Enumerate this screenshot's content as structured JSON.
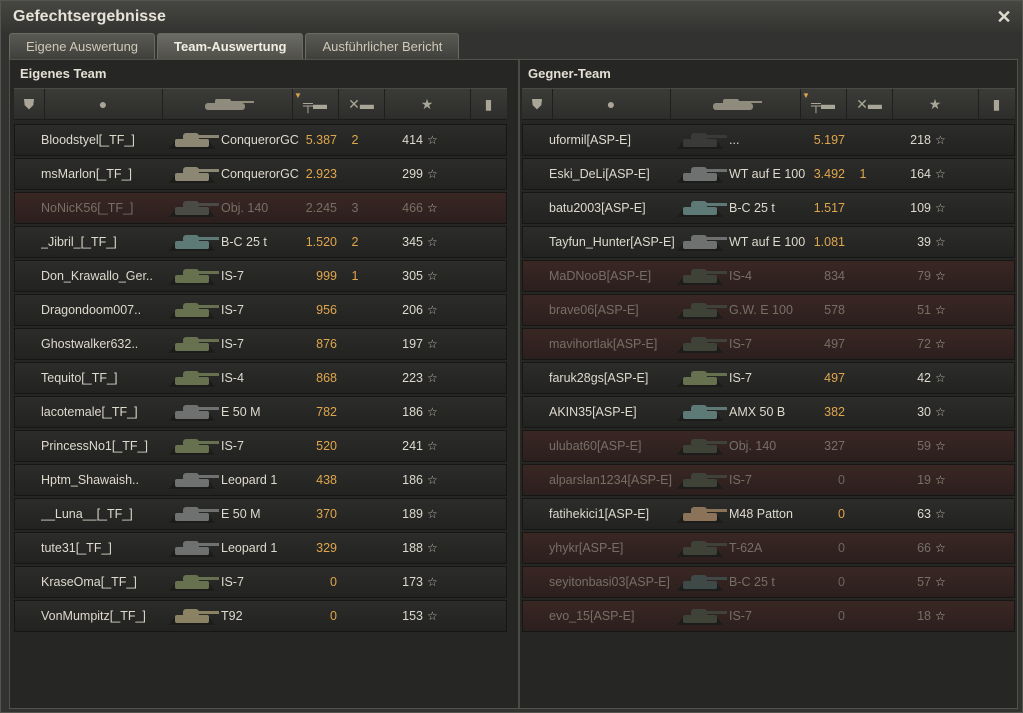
{
  "window": {
    "title": "Gefechtsergebnisse",
    "close_glyph": "✕"
  },
  "tabs": [
    {
      "label": "Eigene Auswertung",
      "active": false
    },
    {
      "label": "Team-Auswertung",
      "active": true
    },
    {
      "label": "Ausführlicher Bericht",
      "active": false
    }
  ],
  "icons": {
    "squad": "shield-icon",
    "player": "person-icon",
    "tank": "tank-icon",
    "damage": "damage-icon",
    "kills": "destroyed-icon",
    "xp": "star-icon",
    "medal": "medal-icon"
  },
  "colors": {
    "damage": "#e0a64d",
    "dead_row": "#3a2724",
    "text": "#dedacd"
  },
  "own_team": {
    "title": "Eigenes Team",
    "rows": [
      {
        "name": "Bloodstyel[_TF_]",
        "tank": "ConquerorGC",
        "damage": "5.387",
        "kills": "2",
        "xp": "414",
        "dead": false,
        "tank_color": "#8b8773"
      },
      {
        "name": "msMarlon[_TF_]",
        "tank": "ConquerorGC",
        "damage": "2.923",
        "kills": "",
        "xp": "299",
        "dead": false,
        "tank_color": "#8b8773"
      },
      {
        "name": "NoNicK56[_TF_]",
        "tank": "Obj. 140",
        "damage": "2.245",
        "kills": "3",
        "xp": "466",
        "dead": true,
        "tank_color": "#4a4b44"
      },
      {
        "name": "_Jibril_[_TF_]",
        "tank": "B-C 25 t",
        "damage": "1.520",
        "kills": "2",
        "xp": "345",
        "dead": false,
        "tank_color": "#5d7a76"
      },
      {
        "name": "Don_Krawallo_Ger..",
        "tank": "IS-7",
        "damage": "999",
        "kills": "1",
        "xp": "305",
        "dead": false,
        "tank_color": "#67704f"
      },
      {
        "name": "Dragondoom007..",
        "tank": "IS-7",
        "damage": "956",
        "kills": "",
        "xp": "206",
        "dead": false,
        "tank_color": "#67704f"
      },
      {
        "name": "Ghostwalker632..",
        "tank": "IS-7",
        "damage": "876",
        "kills": "",
        "xp": "197",
        "dead": false,
        "tank_color": "#67704f"
      },
      {
        "name": "Tequito[_TF_]",
        "tank": "IS-4",
        "damage": "868",
        "kills": "",
        "xp": "223",
        "dead": false,
        "tank_color": "#67704f"
      },
      {
        "name": "lacotemale[_TF_]",
        "tank": "E 50 M",
        "damage": "782",
        "kills": "",
        "xp": "186",
        "dead": false,
        "tank_color": "#6f7170"
      },
      {
        "name": "PrincessNo1[_TF_]",
        "tank": "IS-7",
        "damage": "520",
        "kills": "",
        "xp": "241",
        "dead": false,
        "tank_color": "#67704f"
      },
      {
        "name": "Hptm_Shawaish..",
        "tank": "Leopard 1",
        "damage": "438",
        "kills": "",
        "xp": "186",
        "dead": false,
        "tank_color": "#6f7170"
      },
      {
        "name": "__Luna__[_TF_]",
        "tank": "E 50 M",
        "damage": "370",
        "kills": "",
        "xp": "189",
        "dead": false,
        "tank_color": "#6f7170"
      },
      {
        "name": "tute31[_TF_]",
        "tank": "Leopard 1",
        "damage": "329",
        "kills": "",
        "xp": "188",
        "dead": false,
        "tank_color": "#6f7170"
      },
      {
        "name": "KraseOma[_TF_]",
        "tank": "IS-7",
        "damage": "0",
        "kills": "",
        "xp": "173",
        "dead": false,
        "tank_color": "#67704f"
      },
      {
        "name": "VonMumpitz[_TF_]",
        "tank": "T92",
        "damage": "0",
        "kills": "",
        "xp": "153",
        "dead": false,
        "tank_color": "#8a8262"
      }
    ]
  },
  "enemy_team": {
    "title": "Gegner-Team",
    "rows": [
      {
        "name": "uformil[ASP-E]",
        "tank": "...",
        "damage": "5.197",
        "kills": "",
        "xp": "218",
        "dead": false,
        "tank_color": "#3a3a38"
      },
      {
        "name": "Eski_DeLi[ASP-E]",
        "tank": "WT auf E 100",
        "damage": "3.492",
        "kills": "1",
        "xp": "164",
        "dead": false,
        "tank_color": "#6f7170"
      },
      {
        "name": "batu2003[ASP-E]",
        "tank": "B-C 25 t",
        "damage": "1.517",
        "kills": "",
        "xp": "109",
        "dead": false,
        "tank_color": "#5d7a76"
      },
      {
        "name": "Tayfun_Hunter[ASP-E]",
        "tank": "WT auf E 100",
        "damage": "1.081",
        "kills": "",
        "xp": "39",
        "dead": false,
        "tank_color": "#6f7170"
      },
      {
        "name": "MaDNooB[ASP-E]",
        "tank": "IS-4",
        "damage": "834",
        "kills": "",
        "xp": "79",
        "dead": true,
        "tank_color": "#3f4236"
      },
      {
        "name": "brave06[ASP-E]",
        "tank": "G.W. E 100",
        "damage": "578",
        "kills": "",
        "xp": "51",
        "dead": true,
        "tank_color": "#3f4236"
      },
      {
        "name": "mavihortlak[ASP-E]",
        "tank": "IS-7",
        "damage": "497",
        "kills": "",
        "xp": "72",
        "dead": true,
        "tank_color": "#3f4236"
      },
      {
        "name": "faruk28gs[ASP-E]",
        "tank": "IS-7",
        "damage": "497",
        "kills": "",
        "xp": "42",
        "dead": false,
        "tank_color": "#67704f"
      },
      {
        "name": "AKIN35[ASP-E]",
        "tank": "AMX 50 B",
        "damage": "382",
        "kills": "",
        "xp": "30",
        "dead": false,
        "tank_color": "#5d7a76"
      },
      {
        "name": "ulubat60[ASP-E]",
        "tank": "Obj. 140",
        "damage": "327",
        "kills": "",
        "xp": "59",
        "dead": true,
        "tank_color": "#3f4236"
      },
      {
        "name": "alparslan1234[ASP-E]",
        "tank": "IS-7",
        "damage": "0",
        "kills": "",
        "xp": "19",
        "dead": true,
        "tank_color": "#3f4236"
      },
      {
        "name": "fatihekici1[ASP-E]",
        "tank": "M48 Patton",
        "damage": "0",
        "kills": "",
        "xp": "63",
        "dead": false,
        "tank_color": "#8a7358"
      },
      {
        "name": "yhykr[ASP-E]",
        "tank": "T-62A",
        "damage": "0",
        "kills": "",
        "xp": "66",
        "dead": true,
        "tank_color": "#3f4236"
      },
      {
        "name": "seyitonbasi03[ASP-E]",
        "tank": "B-C 25 t",
        "damage": "0",
        "kills": "",
        "xp": "57",
        "dead": true,
        "tank_color": "#3f4a48"
      },
      {
        "name": "evo_15[ASP-E]",
        "tank": "IS-7",
        "damage": "0",
        "kills": "",
        "xp": "18",
        "dead": true,
        "tank_color": "#3f4236"
      }
    ]
  }
}
